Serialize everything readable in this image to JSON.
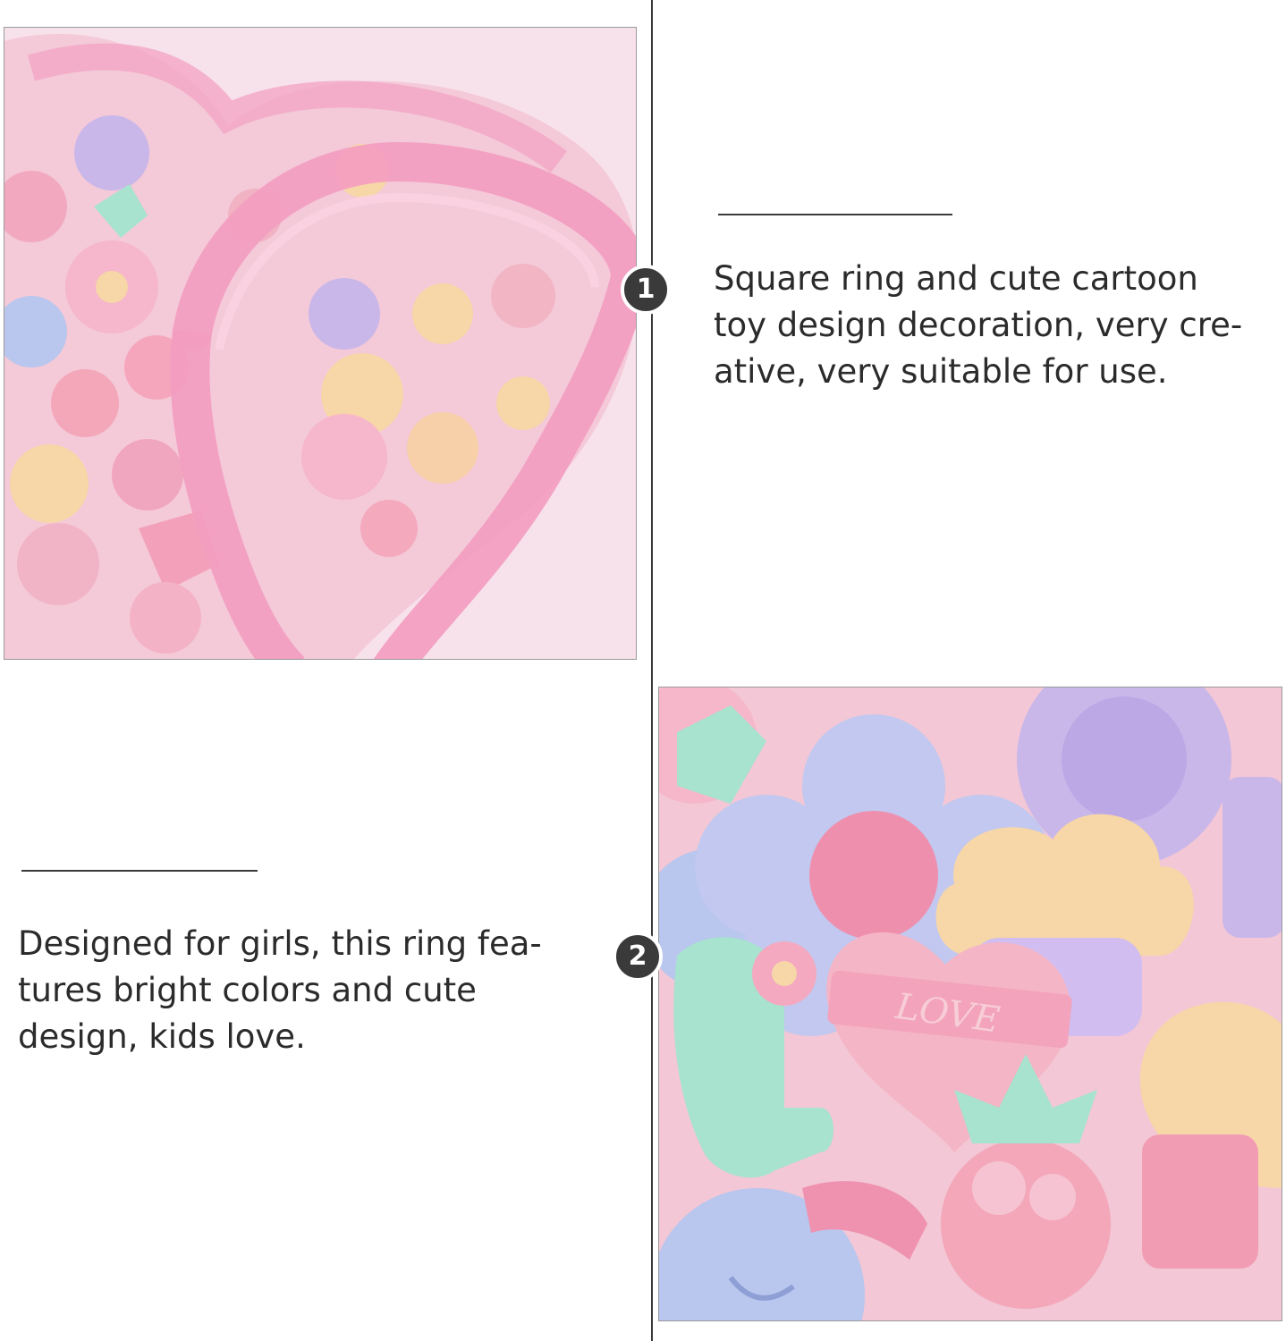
{
  "features": [
    {
      "number": "1",
      "caption_lines": [
        "Square ring and cute cartoon",
        "toy design decoration, very cre-",
        "ative, very suitable for use."
      ]
    },
    {
      "number": "2",
      "caption_lines": [
        "Designed for girls, this ring fea-",
        "tures bright colors and cute",
        "design, kids love."
      ]
    }
  ],
  "photos": {
    "box_photo": {
      "depicts": "pink heart-shaped box of cartoon rings"
    },
    "closeup_photo": {
      "depicts": "close-up of cartoon rings",
      "ring_text": "LOVE"
    }
  },
  "colors": {
    "pink": "#f6c3d3",
    "lilac": "#c9b7ea",
    "mint": "#a7e3cf",
    "peach": "#f7d6a8",
    "periwinkle": "#b9c6ee",
    "badge": "#3a3a3a"
  }
}
